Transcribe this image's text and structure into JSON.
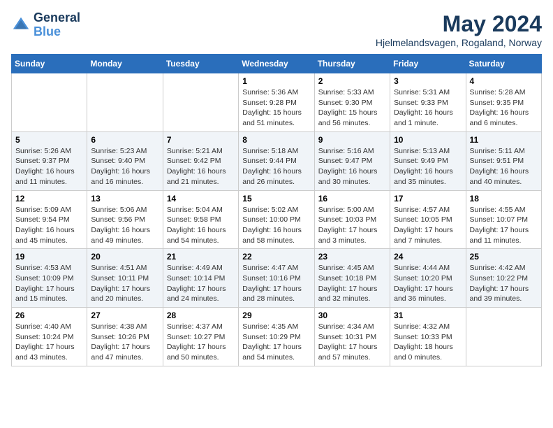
{
  "header": {
    "logo_general": "General",
    "logo_blue": "Blue",
    "month_title": "May 2024",
    "location": "Hjelmelandsvagen, Rogaland, Norway"
  },
  "weekdays": [
    "Sunday",
    "Monday",
    "Tuesday",
    "Wednesday",
    "Thursday",
    "Friday",
    "Saturday"
  ],
  "weeks": [
    [
      {
        "day": "",
        "info": ""
      },
      {
        "day": "",
        "info": ""
      },
      {
        "day": "",
        "info": ""
      },
      {
        "day": "1",
        "info": "Sunrise: 5:36 AM\nSunset: 9:28 PM\nDaylight: 15 hours\nand 51 minutes."
      },
      {
        "day": "2",
        "info": "Sunrise: 5:33 AM\nSunset: 9:30 PM\nDaylight: 15 hours\nand 56 minutes."
      },
      {
        "day": "3",
        "info": "Sunrise: 5:31 AM\nSunset: 9:33 PM\nDaylight: 16 hours\nand 1 minute."
      },
      {
        "day": "4",
        "info": "Sunrise: 5:28 AM\nSunset: 9:35 PM\nDaylight: 16 hours\nand 6 minutes."
      }
    ],
    [
      {
        "day": "5",
        "info": "Sunrise: 5:26 AM\nSunset: 9:37 PM\nDaylight: 16 hours\nand 11 minutes."
      },
      {
        "day": "6",
        "info": "Sunrise: 5:23 AM\nSunset: 9:40 PM\nDaylight: 16 hours\nand 16 minutes."
      },
      {
        "day": "7",
        "info": "Sunrise: 5:21 AM\nSunset: 9:42 PM\nDaylight: 16 hours\nand 21 minutes."
      },
      {
        "day": "8",
        "info": "Sunrise: 5:18 AM\nSunset: 9:44 PM\nDaylight: 16 hours\nand 26 minutes."
      },
      {
        "day": "9",
        "info": "Sunrise: 5:16 AM\nSunset: 9:47 PM\nDaylight: 16 hours\nand 30 minutes."
      },
      {
        "day": "10",
        "info": "Sunrise: 5:13 AM\nSunset: 9:49 PM\nDaylight: 16 hours\nand 35 minutes."
      },
      {
        "day": "11",
        "info": "Sunrise: 5:11 AM\nSunset: 9:51 PM\nDaylight: 16 hours\nand 40 minutes."
      }
    ],
    [
      {
        "day": "12",
        "info": "Sunrise: 5:09 AM\nSunset: 9:54 PM\nDaylight: 16 hours\nand 45 minutes."
      },
      {
        "day": "13",
        "info": "Sunrise: 5:06 AM\nSunset: 9:56 PM\nDaylight: 16 hours\nand 49 minutes."
      },
      {
        "day": "14",
        "info": "Sunrise: 5:04 AM\nSunset: 9:58 PM\nDaylight: 16 hours\nand 54 minutes."
      },
      {
        "day": "15",
        "info": "Sunrise: 5:02 AM\nSunset: 10:00 PM\nDaylight: 16 hours\nand 58 minutes."
      },
      {
        "day": "16",
        "info": "Sunrise: 5:00 AM\nSunset: 10:03 PM\nDaylight: 17 hours\nand 3 minutes."
      },
      {
        "day": "17",
        "info": "Sunrise: 4:57 AM\nSunset: 10:05 PM\nDaylight: 17 hours\nand 7 minutes."
      },
      {
        "day": "18",
        "info": "Sunrise: 4:55 AM\nSunset: 10:07 PM\nDaylight: 17 hours\nand 11 minutes."
      }
    ],
    [
      {
        "day": "19",
        "info": "Sunrise: 4:53 AM\nSunset: 10:09 PM\nDaylight: 17 hours\nand 15 minutes."
      },
      {
        "day": "20",
        "info": "Sunrise: 4:51 AM\nSunset: 10:11 PM\nDaylight: 17 hours\nand 20 minutes."
      },
      {
        "day": "21",
        "info": "Sunrise: 4:49 AM\nSunset: 10:14 PM\nDaylight: 17 hours\nand 24 minutes."
      },
      {
        "day": "22",
        "info": "Sunrise: 4:47 AM\nSunset: 10:16 PM\nDaylight: 17 hours\nand 28 minutes."
      },
      {
        "day": "23",
        "info": "Sunrise: 4:45 AM\nSunset: 10:18 PM\nDaylight: 17 hours\nand 32 minutes."
      },
      {
        "day": "24",
        "info": "Sunrise: 4:44 AM\nSunset: 10:20 PM\nDaylight: 17 hours\nand 36 minutes."
      },
      {
        "day": "25",
        "info": "Sunrise: 4:42 AM\nSunset: 10:22 PM\nDaylight: 17 hours\nand 39 minutes."
      }
    ],
    [
      {
        "day": "26",
        "info": "Sunrise: 4:40 AM\nSunset: 10:24 PM\nDaylight: 17 hours\nand 43 minutes."
      },
      {
        "day": "27",
        "info": "Sunrise: 4:38 AM\nSunset: 10:26 PM\nDaylight: 17 hours\nand 47 minutes."
      },
      {
        "day": "28",
        "info": "Sunrise: 4:37 AM\nSunset: 10:27 PM\nDaylight: 17 hours\nand 50 minutes."
      },
      {
        "day": "29",
        "info": "Sunrise: 4:35 AM\nSunset: 10:29 PM\nDaylight: 17 hours\nand 54 minutes."
      },
      {
        "day": "30",
        "info": "Sunrise: 4:34 AM\nSunset: 10:31 PM\nDaylight: 17 hours\nand 57 minutes."
      },
      {
        "day": "31",
        "info": "Sunrise: 4:32 AM\nSunset: 10:33 PM\nDaylight: 18 hours\nand 0 minutes."
      },
      {
        "day": "",
        "info": ""
      }
    ]
  ]
}
